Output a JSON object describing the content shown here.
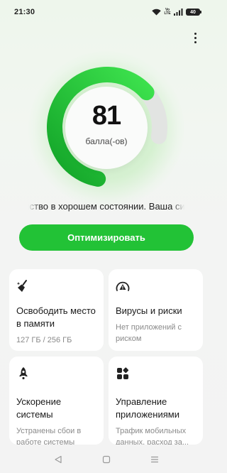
{
  "status_bar": {
    "time": "21:30",
    "volte": "Vo LTE",
    "battery_level": "40",
    "icons": [
      "wifi-icon",
      "volte-icon",
      "signal-icon",
      "battery-icon"
    ]
  },
  "header": {
    "menu_icon": "more-vertical-icon"
  },
  "score": {
    "value": "81",
    "unit": "балла(-ов)",
    "fill_fraction": 0.81,
    "status_text": "Устройство в хорошем состоянии. Ваша система в хорошем состоянии."
  },
  "optimize_button": {
    "label": "Оптимизировать"
  },
  "cards": [
    {
      "icon": "broom-icon",
      "title": "Освободить место в памяти",
      "subtitle": "127 ГБ / 256 ГБ"
    },
    {
      "icon": "shield-alert-icon",
      "title": "Вирусы и риски",
      "subtitle": "Нет приложений с риском"
    },
    {
      "icon": "rocket-icon",
      "title": "Ускорение системы",
      "subtitle": "Устранены сбои в работе системы"
    },
    {
      "icon": "apps-grid-icon",
      "title": "Управление приложениями",
      "subtitle": "Трафик мобильных данных, расход за..."
    }
  ],
  "nav_bar": {
    "buttons": [
      "back-icon",
      "home-icon",
      "recents-icon"
    ]
  },
  "colors": {
    "accent": "#22c236",
    "gauge_light": "#3ee34e",
    "gauge_dark": "#12a328",
    "track": "#e2e4e2",
    "background": "#f3f3f3"
  }
}
